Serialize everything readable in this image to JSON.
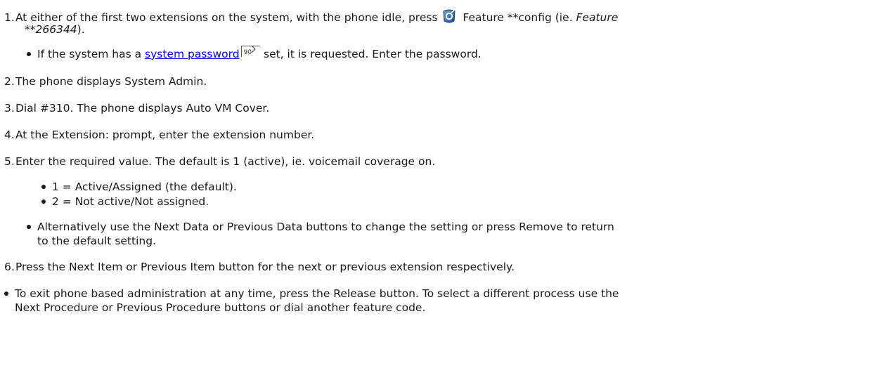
{
  "steps": [
    {
      "number": "1.",
      "text_a": "At either of the first two extensions on the system, with the phone idle, press ",
      "icon": "feature-button-icon",
      "text_b": " Feature **config (ie. ",
      "italic": "Feature",
      "italic_2": "**266344",
      "text_c": ")."
    },
    {
      "number": "2.",
      "text": "The phone displays System Admin."
    },
    {
      "number": "3.",
      "text": "Dial #310. The phone displays Auto VM Cover."
    },
    {
      "number": "4.",
      "text": "At the Extension: prompt, enter the extension number."
    },
    {
      "number": "5.",
      "text": "Enter the required value. The default is 1 (active), ie. voicemail coverage on."
    },
    {
      "number": "6.",
      "text": "Press the Next Item or Previous Item button for the next or previous extension respectively."
    }
  ],
  "password_note": {
    "prefix": "If the system has a ",
    "link_text": "system password",
    "page_ref": "90",
    "suffix": " set, it is requested. Enter the password."
  },
  "values": [
    "1 = Active/Assigned (the default).",
    "2 = Not active/Not assigned."
  ],
  "alternatively": {
    "line1": "Alternatively use the Next Data or Previous Data buttons to change the setting or press Remove to return",
    "line2": "to the default setting."
  },
  "exit_note": {
    "line1": "To exit phone based administration at any time, press the Release button. To select a different process use the",
    "line2": "Next Procedure or Previous Procedure buttons or dial another feature code."
  }
}
